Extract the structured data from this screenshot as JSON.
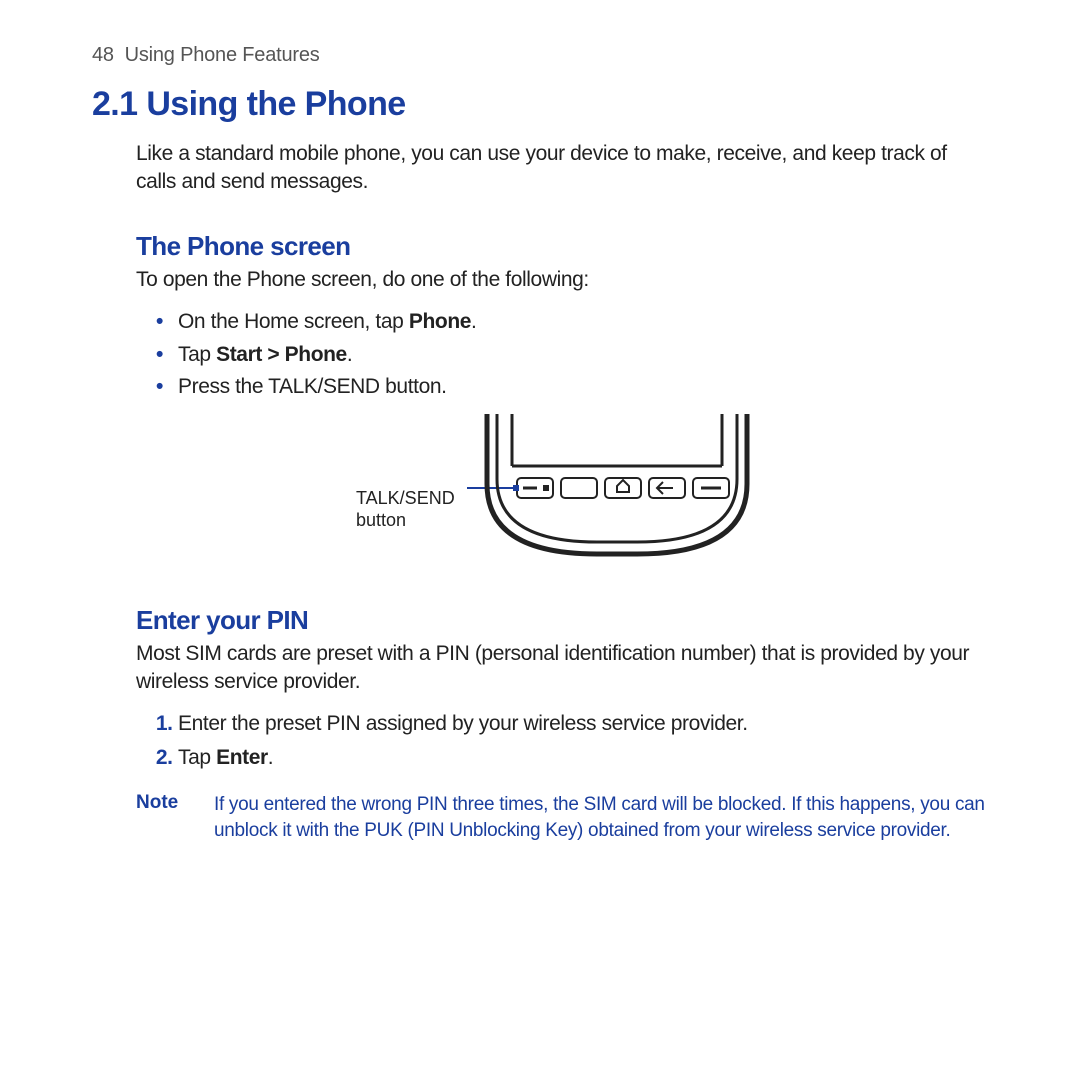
{
  "header": {
    "page_number": "48",
    "chapter": "Using Phone Features"
  },
  "section": {
    "number": "2.1",
    "title": "Using the Phone",
    "intro": "Like a standard mobile phone, you can use your device to make, receive, and keep track of calls and send messages."
  },
  "phone_screen": {
    "heading": "The Phone screen",
    "intro": "To open the Phone screen, do one of the following:",
    "bullets": {
      "b1_pre": "On the Home screen, tap ",
      "b1_bold": "Phone",
      "b1_post": ".",
      "b2_pre": "Tap ",
      "b2_bold": "Start > Phone",
      "b2_post": ".",
      "b3": "Press the TALK/SEND button."
    },
    "illus_caption": "TALK/SEND\nbutton"
  },
  "pin": {
    "heading": "Enter your PIN",
    "intro": "Most SIM cards are preset with a PIN (personal identification number) that is provided by your wireless service provider.",
    "steps": {
      "s1": "Enter the preset PIN assigned by your wireless service provider.",
      "s2_pre": "Tap ",
      "s2_bold": "Enter",
      "s2_post": "."
    }
  },
  "note": {
    "label": "Note",
    "text": "If you entered the wrong PIN three times, the SIM card will be blocked. If this happens, you can unblock it with the PUK (PIN Unblocking Key) obtained from your wireless service provider."
  }
}
